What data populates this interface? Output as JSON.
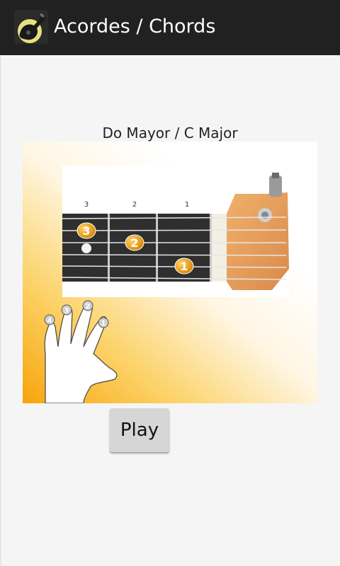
{
  "app": {
    "title": "Acordes / Chords",
    "icon": "guitar-app-icon"
  },
  "chord": {
    "name": "Do Mayor / C Major",
    "fret_labels": [
      "3",
      "2",
      "1"
    ],
    "finger_markers": [
      "3",
      "2",
      "1"
    ],
    "hand_finger_labels": [
      "4",
      "3",
      "2",
      "1"
    ]
  },
  "controls": {
    "play_label": "Play"
  },
  "colors": {
    "actionbar": "#212121",
    "background": "#f5f5f5",
    "fretboard": "#2f2f2f",
    "marker": "#e99b0c",
    "headstock": "#e8a062",
    "gradient": "#fbb316"
  }
}
